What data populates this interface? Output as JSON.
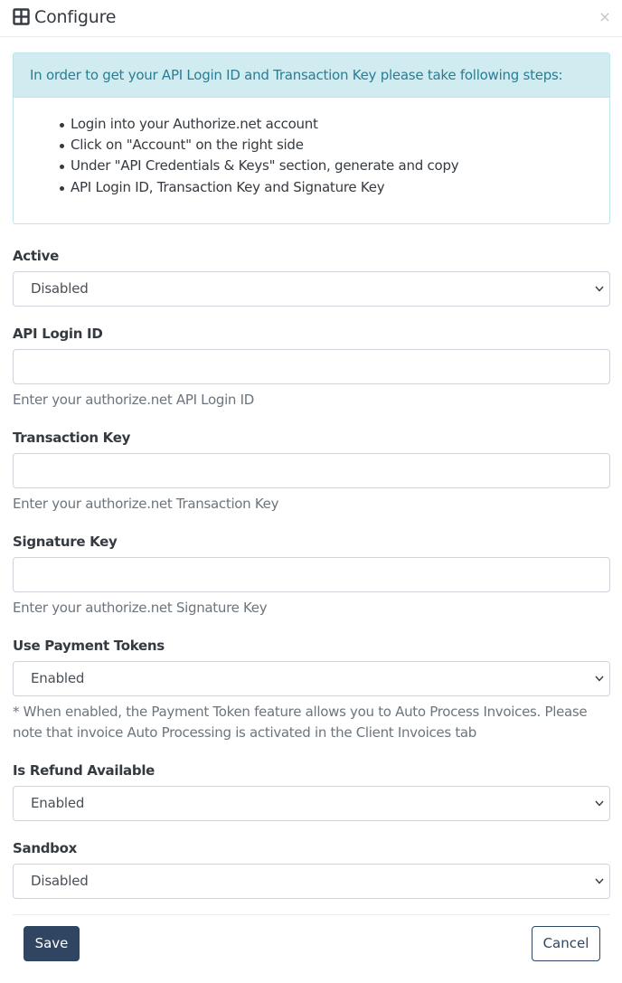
{
  "header": {
    "title": "Configure",
    "icon": "table-icon",
    "close_label": "×"
  },
  "info": {
    "heading": "In order to get your API Login ID and Transaction Key please take following steps:",
    "steps": [
      "Login into your Authorize.net account",
      "Click on \"Account\" on the right side",
      "Under \"API Credentials & Keys\" section, generate and copy",
      "API Login ID, Transaction Key and Signature Key"
    ]
  },
  "fields": {
    "active": {
      "label": "Active",
      "value": "Disabled"
    },
    "api_login_id": {
      "label": "API Login ID",
      "value": "",
      "help": "Enter your authorize.net API Login ID"
    },
    "transaction_key": {
      "label": "Transaction Key",
      "value": "",
      "help": "Enter your authorize.net Transaction Key"
    },
    "signature_key": {
      "label": "Signature Key",
      "value": "",
      "help": "Enter your authorize.net Signature Key"
    },
    "use_payment_tokens": {
      "label": "Use Payment Tokens",
      "value": "Enabled",
      "help": "* When enabled, the Payment Token feature allows you to Auto Process Invoices. Please note that invoice Auto Processing is activated in the Client Invoices tab"
    },
    "is_refund_available": {
      "label": "Is Refund Available",
      "value": "Enabled"
    },
    "sandbox": {
      "label": "Sandbox",
      "value": "Disabled"
    }
  },
  "buttons": {
    "save": "Save",
    "cancel": "Cancel"
  },
  "colors": {
    "primary": "#2f4562",
    "info_bg": "#d1ecf1",
    "info_text": "#2a7d92",
    "border": "#ced4da"
  }
}
